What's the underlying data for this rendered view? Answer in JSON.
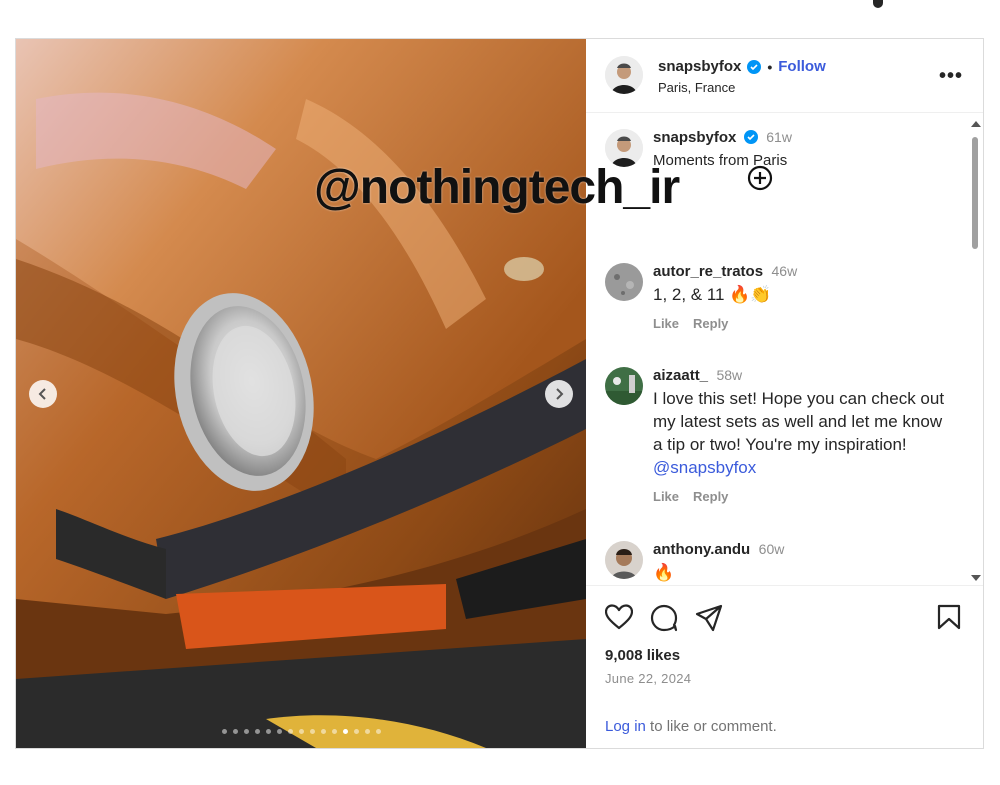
{
  "watermark": "@nothingtech_ir",
  "post": {
    "slide_count": 15,
    "active_slide": 12,
    "author": {
      "username": "snapsbyfox",
      "separator": "•",
      "follow_label": "Follow",
      "location": "Paris, France"
    },
    "more_label": "•••",
    "caption": {
      "username": "snapsbyfox",
      "time": "61w",
      "text": "Moments from Paris"
    },
    "comments": [
      {
        "username": "autor_re_tratos",
        "time": "46w",
        "text": "1, 2, & 11 🔥👏",
        "like_label": "Like",
        "reply_label": "Reply"
      },
      {
        "username": "aizaatt_",
        "time": "58w",
        "text": "I love this set! Hope you can check out my latest sets as well and let me know a tip or two! You're my inspiration! ",
        "mention": "@snapsbyfox",
        "like_label": "Like",
        "reply_label": "Reply"
      },
      {
        "username": "anthony.andu",
        "time": "60w",
        "text": "🔥"
      }
    ],
    "likes": "9,008 likes",
    "date": "June 22, 2024",
    "login": {
      "link": "Log in",
      "rest": " to like or comment."
    }
  },
  "icons": [
    "heart-icon",
    "comment-icon",
    "share-icon",
    "bookmark-icon",
    "verified-icon",
    "chevron-left-icon",
    "chevron-right-icon",
    "plus-circle-icon"
  ],
  "colors": {
    "accent": "#3b5bdb",
    "verified": "#0095f6",
    "car_paint": "#b5651d"
  }
}
